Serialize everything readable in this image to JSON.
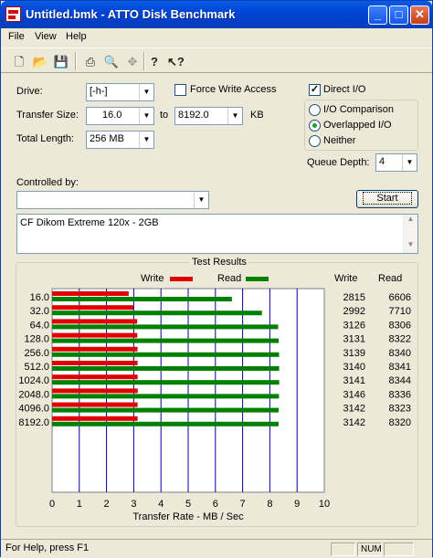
{
  "window": {
    "title": "Untitled.bmk - ATTO Disk Benchmark"
  },
  "menu": [
    "File",
    "View",
    "Help"
  ],
  "toolbar": [
    "new",
    "open",
    "save",
    "print",
    "print-preview",
    "move",
    "help",
    "context-help"
  ],
  "drive": {
    "label": "Drive:",
    "value": "[-h-]"
  },
  "force_write": {
    "label": "Force Write Access",
    "checked": false
  },
  "direct_io": {
    "label": "Direct I/O",
    "checked": true
  },
  "transfer_size": {
    "label": "Transfer Size:",
    "from": "16.0",
    "to_label": "to",
    "to": "8192.0",
    "unit": "KB"
  },
  "total_length": {
    "label": "Total Length:",
    "value": "256 MB"
  },
  "io_modes": [
    {
      "label": "I/O Comparison",
      "selected": false
    },
    {
      "label": "Overlapped I/O",
      "selected": true
    },
    {
      "label": "Neither",
      "selected": false
    }
  ],
  "queue_depth": {
    "label": "Queue Depth:",
    "value": "4"
  },
  "controlled_by": {
    "label": "Controlled by:",
    "value": ""
  },
  "start_button": "Start",
  "description": "CF Dikom Extreme 120x - 2GB",
  "results": {
    "title": "Test Results",
    "legend_write": "Write",
    "legend_read": "Read",
    "col_write": "Write",
    "col_read": "Read"
  },
  "chart_data": {
    "type": "bar",
    "orientation": "horizontal",
    "categories": [
      "16.0",
      "32.0",
      "64.0",
      "128.0",
      "256.0",
      "512.0",
      "1024.0",
      "2048.0",
      "4096.0",
      "8192.0"
    ],
    "series": [
      {
        "name": "Write",
        "color": "#e00000",
        "values": [
          2815,
          2992,
          3126,
          3131,
          3139,
          3140,
          3141,
          3146,
          3142,
          3142
        ]
      },
      {
        "name": "Read",
        "color": "#008000",
        "values": [
          6606,
          7710,
          8306,
          8322,
          8340,
          8341,
          8344,
          8336,
          8323,
          8320
        ]
      }
    ],
    "x_ticks": [
      "0",
      "1",
      "2",
      "3",
      "4",
      "5",
      "6",
      "7",
      "8",
      "9",
      "10"
    ],
    "xlabel": "Transfer Rate - MB / Sec",
    "xlim": [
      0,
      10
    ],
    "units_scale": 1000,
    "grid": true
  },
  "status": {
    "text": "For Help, press F1",
    "num": "NUM"
  },
  "colors": {
    "titlebar": "#0145d4",
    "plot_bg": "#ffffff",
    "gridline": "#0000a0",
    "write": "#e00000",
    "read": "#008000"
  }
}
